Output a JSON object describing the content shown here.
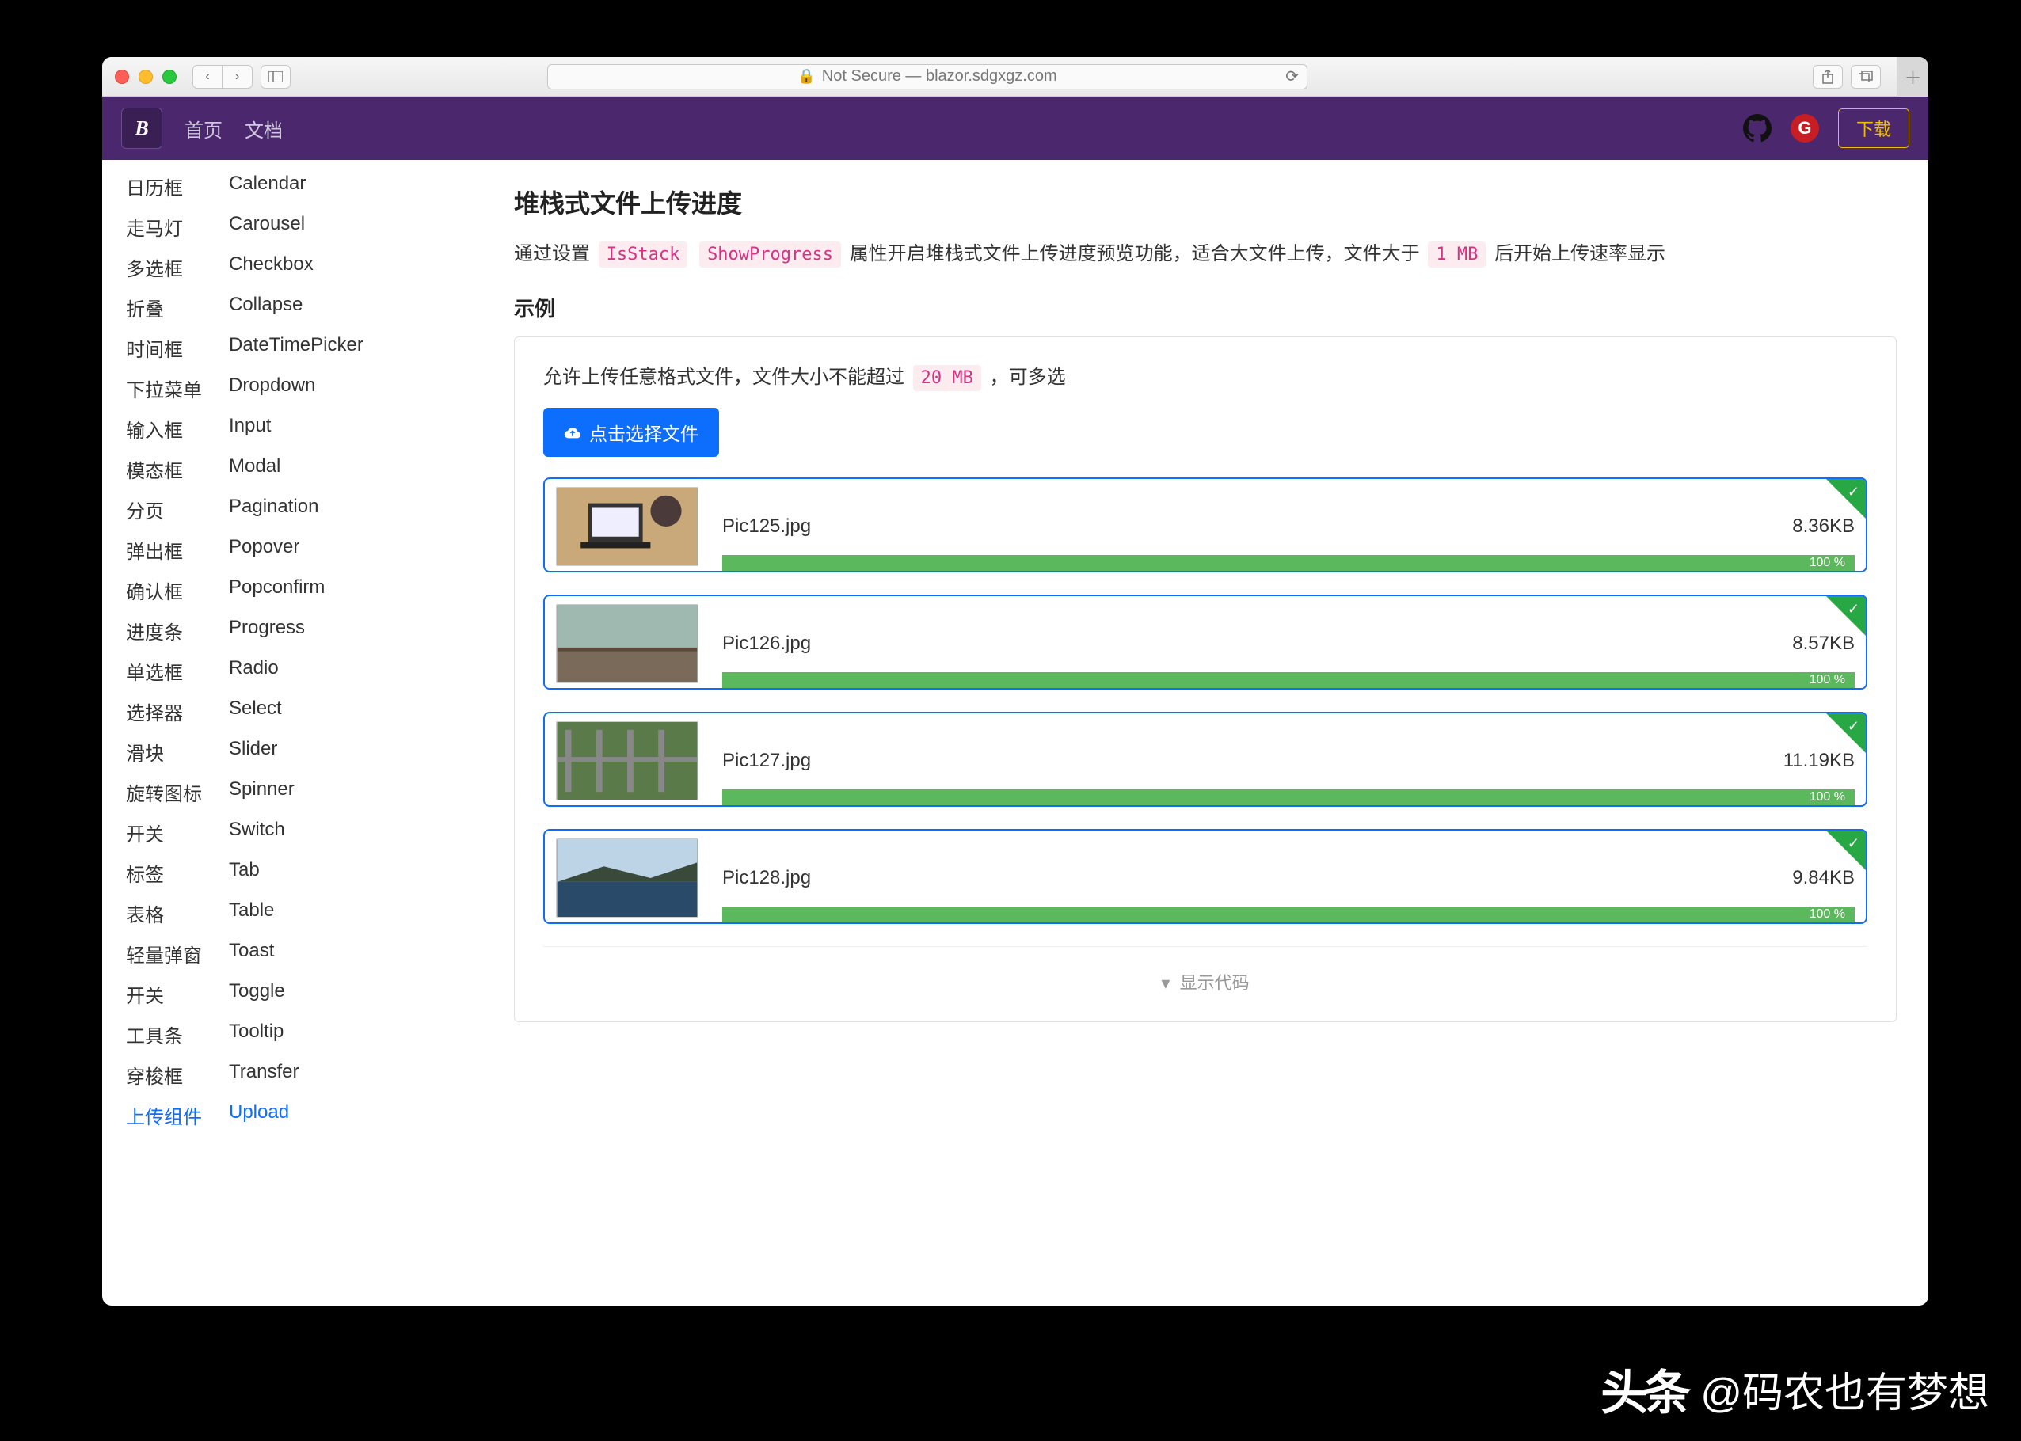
{
  "browser": {
    "address_prefix": "Not Secure —",
    "address": "blazor.sdgxgz.com"
  },
  "header": {
    "nav_home": "首页",
    "nav_docs": "文档",
    "download": "下载",
    "gitee_letter": "G"
  },
  "sidebar": [
    {
      "cn": "日历框",
      "en": "Calendar"
    },
    {
      "cn": "走马灯",
      "en": "Carousel"
    },
    {
      "cn": "多选框",
      "en": "Checkbox"
    },
    {
      "cn": "折叠",
      "en": "Collapse"
    },
    {
      "cn": "时间框",
      "en": "DateTimePicker"
    },
    {
      "cn": "下拉菜单",
      "en": "Dropdown"
    },
    {
      "cn": "输入框",
      "en": "Input"
    },
    {
      "cn": "模态框",
      "en": "Modal"
    },
    {
      "cn": "分页",
      "en": "Pagination"
    },
    {
      "cn": "弹出框",
      "en": "Popover"
    },
    {
      "cn": "确认框",
      "en": "Popconfirm"
    },
    {
      "cn": "进度条",
      "en": "Progress"
    },
    {
      "cn": "单选框",
      "en": "Radio"
    },
    {
      "cn": "选择器",
      "en": "Select"
    },
    {
      "cn": "滑块",
      "en": "Slider"
    },
    {
      "cn": "旋转图标",
      "en": "Spinner"
    },
    {
      "cn": "开关",
      "en": "Switch"
    },
    {
      "cn": "标签",
      "en": "Tab"
    },
    {
      "cn": "表格",
      "en": "Table"
    },
    {
      "cn": "轻量弹窗",
      "en": "Toast"
    },
    {
      "cn": "开关",
      "en": "Toggle"
    },
    {
      "cn": "工具条",
      "en": "Tooltip"
    },
    {
      "cn": "穿梭框",
      "en": "Transfer"
    },
    {
      "cn": "上传组件",
      "en": "Upload",
      "active": true
    }
  ],
  "main": {
    "title": "堆栈式文件上传进度",
    "desc_pre": "通过设置",
    "code1": "IsStack",
    "code2": "ShowProgress",
    "desc_mid": "属性开启堆栈式文件上传进度预览功能，适合大文件上传，文件大于",
    "code3": "1 MB",
    "desc_post": "后开始上传速率显示",
    "example_label": "示例",
    "hint_pre": "允许上传任意格式文件，文件大小不能超过",
    "hint_code": "20 MB",
    "hint_post": "，可多选",
    "choose_btn": "点击选择文件",
    "files": [
      {
        "name": "Pic125.jpg",
        "size": "8.36KB",
        "pct": "100 %"
      },
      {
        "name": "Pic126.jpg",
        "size": "8.57KB",
        "pct": "100 %"
      },
      {
        "name": "Pic127.jpg",
        "size": "11.19KB",
        "pct": "100 %"
      },
      {
        "name": "Pic128.jpg",
        "size": "9.84KB",
        "pct": "100 %"
      }
    ],
    "show_code": "显示代码"
  },
  "watermark": {
    "brand": "头条",
    "handle": "@码农也有梦想"
  }
}
